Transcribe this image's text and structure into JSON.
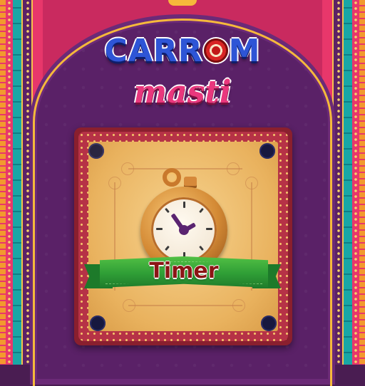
{
  "game": {
    "title_line1": "CARR",
    "title_line1_end": "M",
    "title_line2": "masti",
    "mode_label": "Timer"
  },
  "icons": [
    "striker-o-icon",
    "stopwatch-icon",
    "carrom-board-icon",
    "ribbon-banner"
  ],
  "colors": {
    "title_blue": "#2e55d6",
    "title_pink": "#e9377d",
    "background_purple": "#5a2167",
    "board_frame": "#b63246",
    "board_surface": "#e9b25e",
    "ribbon_green": "#2f9e36",
    "label_red": "#8b1515"
  }
}
